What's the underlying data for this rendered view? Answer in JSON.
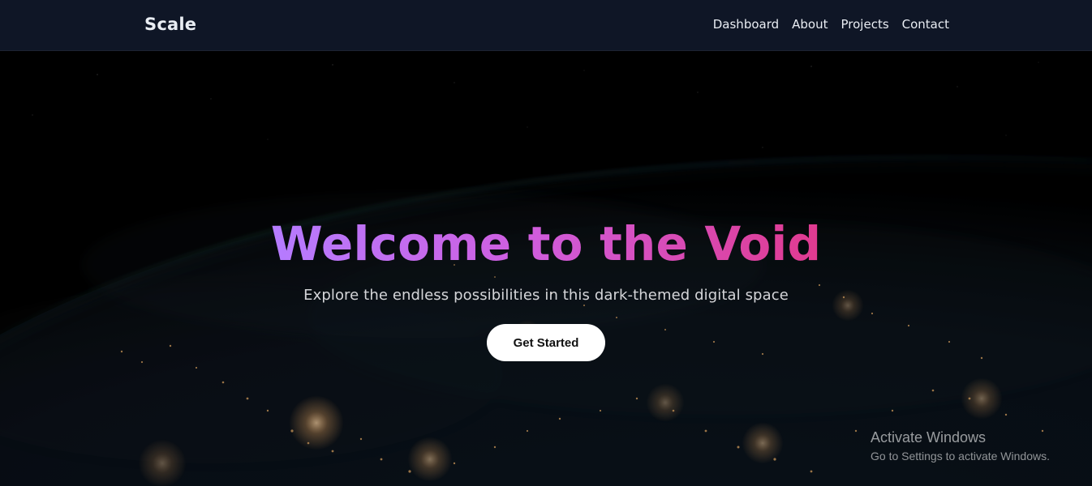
{
  "header": {
    "brand": "Scale",
    "nav": [
      {
        "label": "Dashboard"
      },
      {
        "label": "About"
      },
      {
        "label": "Projects"
      },
      {
        "label": "Contact"
      }
    ]
  },
  "hero": {
    "title": "Welcome to the Void",
    "subtitle": "Explore the endless possibilities in this dark-themed digital space",
    "cta_label": "Get Started",
    "title_gradient": [
      "#b57cff",
      "#cf5ee0",
      "#e03a8f"
    ]
  },
  "os_watermark": {
    "title": "Activate Windows",
    "subtitle": "Go to Settings to activate Windows."
  },
  "colors": {
    "topbar_bg": "#0f1626",
    "text_primary": "#e9edf3",
    "cta_bg": "#ffffff",
    "cta_text": "#111111"
  }
}
